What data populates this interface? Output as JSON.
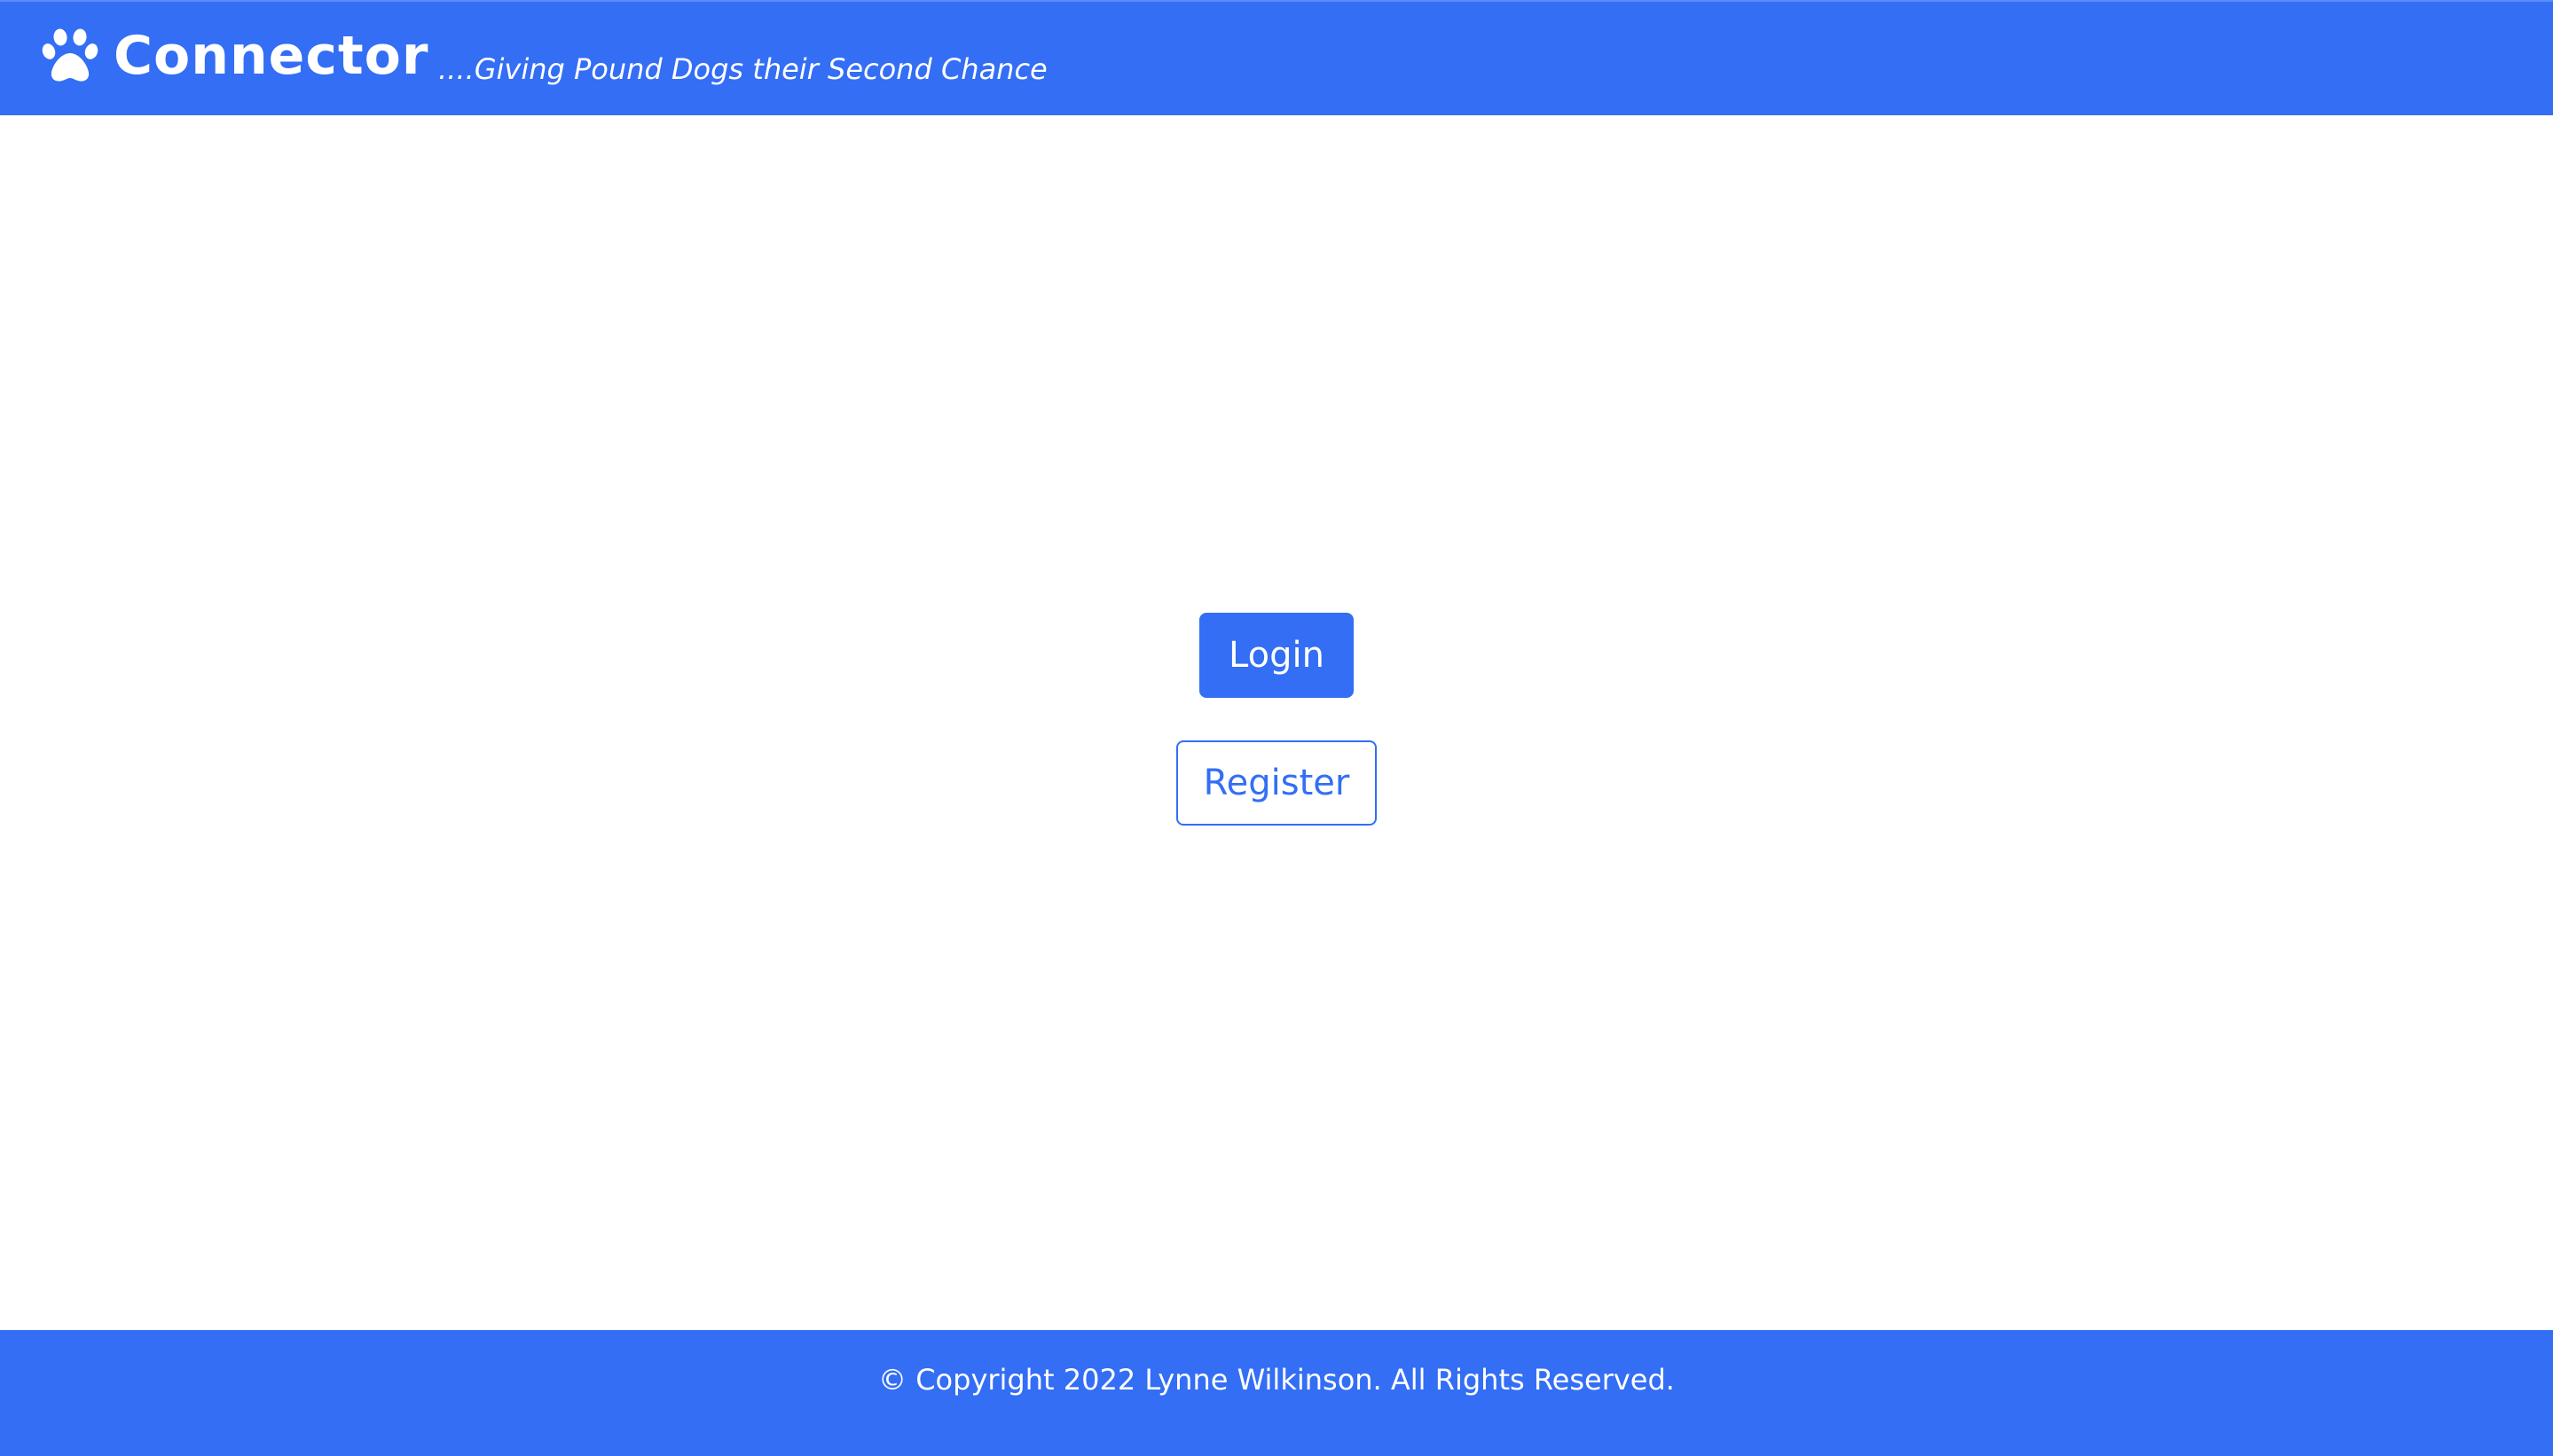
{
  "header": {
    "brand_name": "Connector",
    "tagline": "....Giving Pound Dogs their Second Chance",
    "logo_icon": "paw-icon"
  },
  "main": {
    "login_label": "Login",
    "register_label": "Register"
  },
  "footer": {
    "copyright": "© Copyright 2022 Lynne Wilkinson. All Rights Reserved."
  },
  "colors": {
    "brand_blue": "#336ef5",
    "white": "#ffffff"
  }
}
